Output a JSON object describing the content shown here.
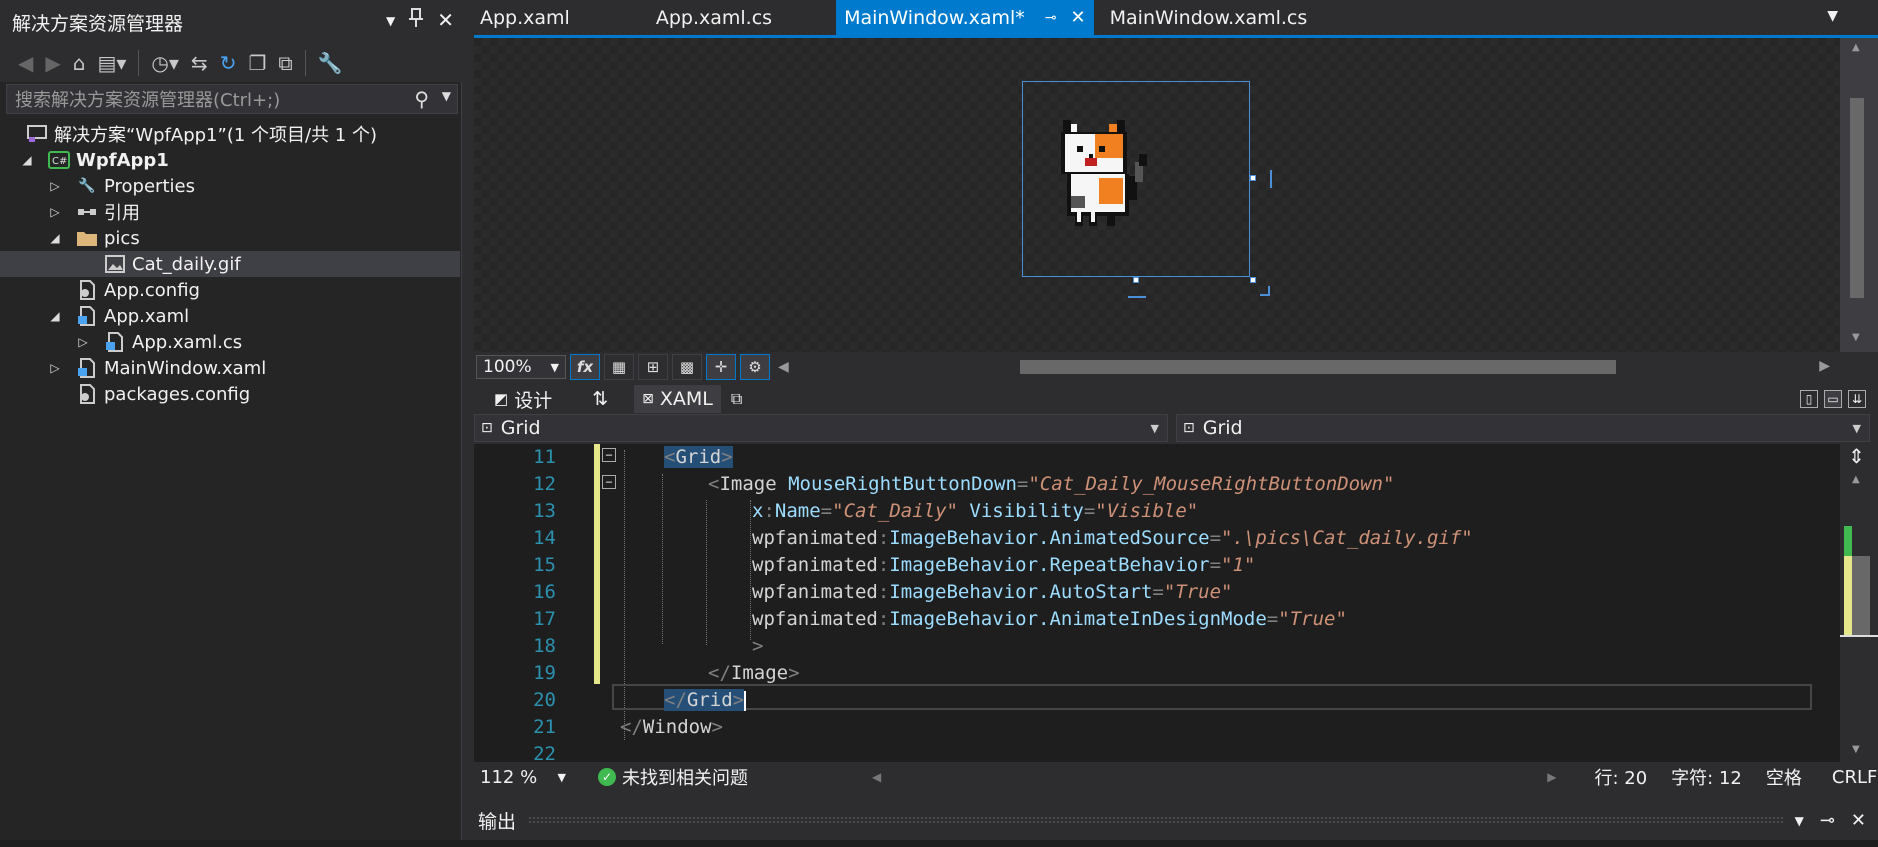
{
  "solution_explorer": {
    "title": "解决方案资源管理器",
    "search_placeholder": "搜索解决方案资源管理器(Ctrl+;)",
    "tree": [
      {
        "label": "解决方案“WpfApp1”(1 个项目/共 1 个)",
        "icon": "solution-icon"
      },
      {
        "label": "WpfApp1",
        "icon": "csharp-project-icon",
        "bold": true
      },
      {
        "label": "Properties",
        "icon": "wrench-icon"
      },
      {
        "label": "引用",
        "icon": "references-icon"
      },
      {
        "label": "pics",
        "icon": "folder-icon"
      },
      {
        "label": "Cat_daily.gif",
        "icon": "image-file-icon"
      },
      {
        "label": "App.config",
        "icon": "config-file-icon"
      },
      {
        "label": "App.xaml",
        "icon": "xaml-file-icon"
      },
      {
        "label": "App.xaml.cs",
        "icon": "cs-file-icon"
      },
      {
        "label": "MainWindow.xaml",
        "icon": "xaml-file-icon"
      },
      {
        "label": "packages.config",
        "icon": "config-file-icon"
      }
    ]
  },
  "tabs": [
    {
      "label": "App.xaml",
      "active": false
    },
    {
      "label": "App.xaml.cs",
      "active": false
    },
    {
      "label": "MainWindow.xaml*",
      "active": true
    },
    {
      "label": "MainWindow.xaml.cs",
      "active": false
    }
  ],
  "designer": {
    "zoom": "100%"
  },
  "split_tabs": {
    "design": "设计",
    "swap": "⇅",
    "xaml": "XAML"
  },
  "nav": {
    "left": "Grid",
    "right": "Grid"
  },
  "code": {
    "line_numbers": [
      "11",
      "12",
      "13",
      "14",
      "15",
      "16",
      "17",
      "18",
      "19",
      "20",
      "21",
      "22"
    ],
    "lines": {
      "l11_tag": "Grid",
      "l12_tag": "Image",
      "l12_attr": "MouseRightButtonDown",
      "l12_val": "\"Cat_Daily_MouseRightButtonDown\"",
      "l13_ns": "x",
      "l13_attr": "Name",
      "l13_val": "\"Cat_Daily\"",
      "l13_attr2": "Visibility",
      "l13_val2": "\"Visible\"",
      "l14_ns": "wpfanimated",
      "l14_attr": "ImageBehavior.AnimatedSource",
      "l14_val": "\".\\pics\\Cat_daily.gif\"",
      "l15_ns": "wpfanimated",
      "l15_attr": "ImageBehavior.RepeatBehavior",
      "l15_val": "\"1\"",
      "l16_ns": "wpfanimated",
      "l16_attr": "ImageBehavior.AutoStart",
      "l16_val": "\"True\"",
      "l17_ns": "wpfanimated",
      "l17_attr": "ImageBehavior.AnimateInDesignMode",
      "l17_val": "\"True\"",
      "l19_tag": "Image",
      "l20_tag": "Grid",
      "l21_tag": "Window"
    }
  },
  "status": {
    "zoom": "112 %",
    "issues": "未找到相关问题",
    "line": "行: 20",
    "char": "字符: 12",
    "whitespace": "空格",
    "eol": "CRLF"
  },
  "output": {
    "title": "输出"
  },
  "colors": {
    "accent": "#007acc",
    "background": "#2d2d30",
    "editor": "#1e1e1e",
    "ok_green": "#3fb950"
  }
}
